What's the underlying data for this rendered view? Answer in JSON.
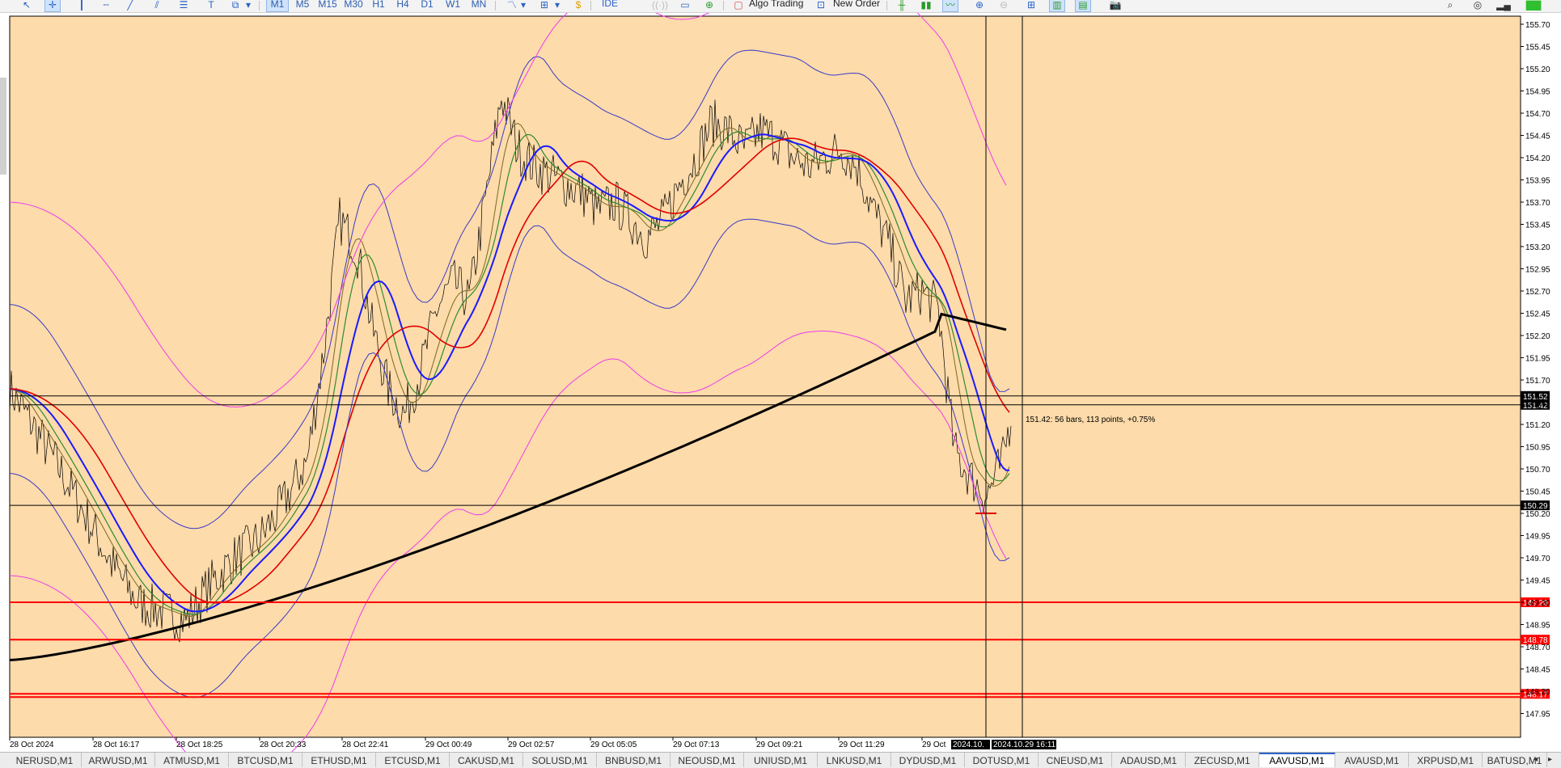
{
  "toolbar": {
    "timeframes": [
      "M1",
      "M5",
      "M15",
      "M30",
      "H1",
      "H4",
      "D1",
      "W1",
      "MN"
    ],
    "selected_timeframe": "M1",
    "algo_trading_label": "Algo Trading",
    "new_order_label": "New Order",
    "ide_label": "IDE"
  },
  "chart": {
    "symbol": "AAVUSD",
    "timeframe": "M1",
    "background_color": "#fddbaa",
    "price_axis_labels": [
      "155.70",
      "155.45",
      "155.20",
      "154.95",
      "154.70",
      "154.45",
      "154.20",
      "153.95",
      "153.70",
      "153.45",
      "153.20",
      "152.95",
      "152.70",
      "152.45",
      "152.20",
      "151.95",
      "151.70",
      "151.45",
      "151.20",
      "150.95",
      "150.70",
      "150.45",
      "150.20",
      "149.95",
      "149.70",
      "149.45",
      "149.20",
      "148.95",
      "148.70",
      "148.45",
      "148.20",
      "147.95"
    ],
    "time_axis_labels": [
      "28 Oct 2024",
      "28 Oct 16:17",
      "28 Oct 18:25",
      "28 Oct 20:33",
      "28 Oct 22:41",
      "29 Oct 00:49",
      "29 Oct 02:57",
      "29 Oct 05:05",
      "29 Oct 07:13",
      "29 Oct 09:21",
      "29 Oct 11:29",
      "29 Oct"
    ],
    "crosshair_time_label_1": "2024.10.",
    "crosshair_time_label_2": "2024.10.29 16:11",
    "measure_text": "151.42: 56 bars, 113 points, +0.75%",
    "horizontal_levels": [
      {
        "label": "149.20",
        "color": "#ff0000"
      },
      {
        "label": "148.78",
        "color": "#ff0000"
      },
      {
        "label": "148.17",
        "color": "#ff0000"
      }
    ],
    "black_levels": [
      {
        "label": "151.52"
      },
      {
        "label": "151.42"
      },
      {
        "label": "150.29"
      }
    ],
    "colors": {
      "ma_long": "#000000",
      "ma_red": "#e00000",
      "ma_blue": "#1a1aff",
      "ma_green": "#2e8b2e",
      "ma_olive": "#7a6a20",
      "bollinger_inner": "#3a3ac8",
      "bollinger_outer": "#ee3bee",
      "candles": "#000000"
    }
  },
  "symbol_tabs": [
    "NERUSD,M1",
    "ARWUSD,M1",
    "ATMUSD,M1",
    "BTCUSD,M1",
    "ETHUSD,M1",
    "ETCUSD,M1",
    "CAKUSD,M1",
    "SOLUSD,M1",
    "BNBUSD,M1",
    "NEOUSD,M1",
    "UNIUSD,M1",
    "LNKUSD,M1",
    "DYDUSD,M1",
    "DOTUSD,M1",
    "CNEUSD,M1",
    "ADAUSD,M1",
    "ZECUSD,M1",
    "AAVUSD,M1",
    "AVAUSD,M1",
    "XRPUSD,M1",
    "BATUSD,M1"
  ],
  "active_tab": "AAVUSD,M1"
}
